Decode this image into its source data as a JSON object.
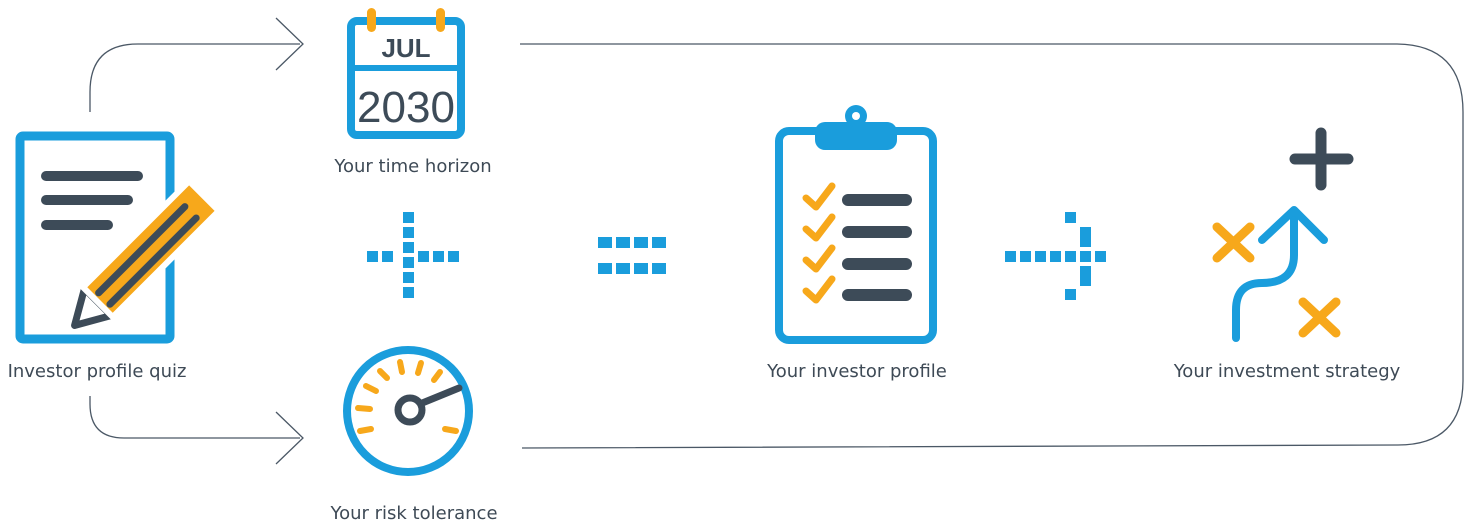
{
  "labels": {
    "quiz": "Investor profile quiz",
    "time_horizon": "Your time horizon",
    "risk_tolerance": "Your risk tolerance",
    "investor_profile": "Your investor profile",
    "investment_strategy": "Your investment strategy"
  },
  "calendar": {
    "month": "JUL",
    "year": "2030"
  },
  "operators": {
    "plus": "plus-icon",
    "equals": "equals-icon",
    "arrow": "arrow-right-icon"
  },
  "colors": {
    "blue": "#1a9ddc",
    "orange": "#f7a81b",
    "dark": "#3d4b58",
    "line": "#4b5866"
  }
}
